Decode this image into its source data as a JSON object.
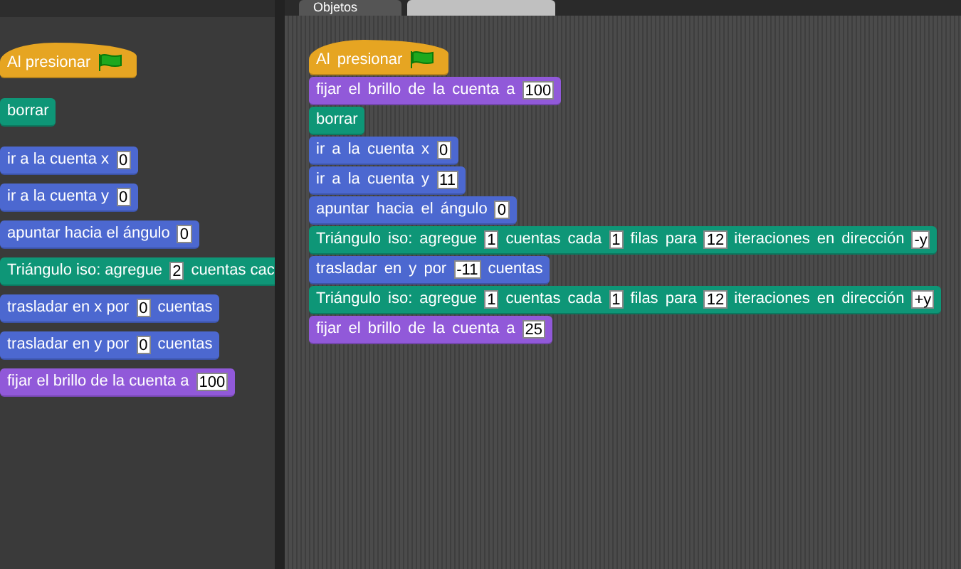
{
  "tabs": [
    {
      "label": "Objetos",
      "selected": true
    },
    {
      "selected": false
    }
  ],
  "palette": {
    "blocks": [
      {
        "kind": "hat",
        "parts": [
          {
            "kind": "text",
            "text": "Al presionar"
          },
          {
            "kind": "flag"
          }
        ]
      },
      {
        "kind": "pen",
        "parts": [
          {
            "kind": "text",
            "text": "borrar"
          }
        ]
      },
      {
        "kind": "motion",
        "parts": [
          {
            "kind": "text",
            "text": "ir a la cuenta x"
          },
          {
            "kind": "input",
            "value": "0"
          }
        ]
      },
      {
        "kind": "motion",
        "parts": [
          {
            "kind": "text",
            "text": "ir a la cuenta y"
          },
          {
            "kind": "input",
            "value": "0"
          }
        ]
      },
      {
        "kind": "motion",
        "parts": [
          {
            "kind": "text",
            "text": "apuntar hacia el ángulo"
          },
          {
            "kind": "input",
            "value": "0"
          }
        ]
      },
      {
        "kind": "pen",
        "parts": [
          {
            "kind": "text",
            "text": "Triángulo iso: agregue"
          },
          {
            "kind": "input",
            "value": "2"
          },
          {
            "kind": "text",
            "text": "cuentas cac"
          }
        ]
      },
      {
        "kind": "motion",
        "parts": [
          {
            "kind": "text",
            "text": "trasladar en x por"
          },
          {
            "kind": "input",
            "value": "0"
          },
          {
            "kind": "text",
            "text": "cuentas"
          }
        ]
      },
      {
        "kind": "motion",
        "parts": [
          {
            "kind": "text",
            "text": "trasladar en y por"
          },
          {
            "kind": "input",
            "value": "0"
          },
          {
            "kind": "text",
            "text": "cuentas"
          }
        ]
      },
      {
        "kind": "looks",
        "parts": [
          {
            "kind": "text",
            "text": "fijar el brillo de la cuenta a"
          },
          {
            "kind": "input",
            "value": "100"
          }
        ]
      }
    ]
  },
  "script": {
    "blocks": [
      {
        "kind": "hat",
        "parts": [
          {
            "kind": "text",
            "text": "Al presionar"
          },
          {
            "kind": "flag"
          }
        ]
      },
      {
        "kind": "looks",
        "parts": [
          {
            "kind": "text",
            "text": "fijar el brillo de la cuenta a"
          },
          {
            "kind": "input",
            "value": "100"
          }
        ]
      },
      {
        "kind": "pen",
        "parts": [
          {
            "kind": "text",
            "text": "borrar"
          }
        ]
      },
      {
        "kind": "motion",
        "parts": [
          {
            "kind": "text",
            "text": "ir a la cuenta x"
          },
          {
            "kind": "input",
            "value": "0"
          }
        ]
      },
      {
        "kind": "motion",
        "parts": [
          {
            "kind": "text",
            "text": "ir a la cuenta y"
          },
          {
            "kind": "input",
            "value": "11"
          }
        ]
      },
      {
        "kind": "motion",
        "parts": [
          {
            "kind": "text",
            "text": "apuntar hacia el ángulo"
          },
          {
            "kind": "input",
            "value": "0"
          }
        ]
      },
      {
        "kind": "pen",
        "parts": [
          {
            "kind": "text",
            "text": "Triángulo iso: agregue"
          },
          {
            "kind": "input",
            "value": "1"
          },
          {
            "kind": "text",
            "text": "cuentas cada"
          },
          {
            "kind": "input",
            "value": "1"
          },
          {
            "kind": "text",
            "text": "filas para"
          },
          {
            "kind": "input",
            "value": "12"
          },
          {
            "kind": "text",
            "text": "iteraciones en dirección"
          },
          {
            "kind": "input",
            "value": "-y"
          }
        ]
      },
      {
        "kind": "motion",
        "parts": [
          {
            "kind": "text",
            "text": "trasladar en y por"
          },
          {
            "kind": "input",
            "value": "-11"
          },
          {
            "kind": "text",
            "text": "cuentas"
          }
        ]
      },
      {
        "kind": "pen",
        "parts": [
          {
            "kind": "text",
            "text": "Triángulo iso: agregue"
          },
          {
            "kind": "input",
            "value": "1"
          },
          {
            "kind": "text",
            "text": "cuentas cada"
          },
          {
            "kind": "input",
            "value": "1"
          },
          {
            "kind": "text",
            "text": "filas para"
          },
          {
            "kind": "input",
            "value": "12"
          },
          {
            "kind": "text",
            "text": "iteraciones en dirección"
          },
          {
            "kind": "input",
            "value": "+y"
          }
        ]
      },
      {
        "kind": "looks",
        "parts": [
          {
            "kind": "text",
            "text": "fijar el brillo de la cuenta a"
          },
          {
            "kind": "input",
            "value": "25"
          }
        ]
      }
    ]
  }
}
